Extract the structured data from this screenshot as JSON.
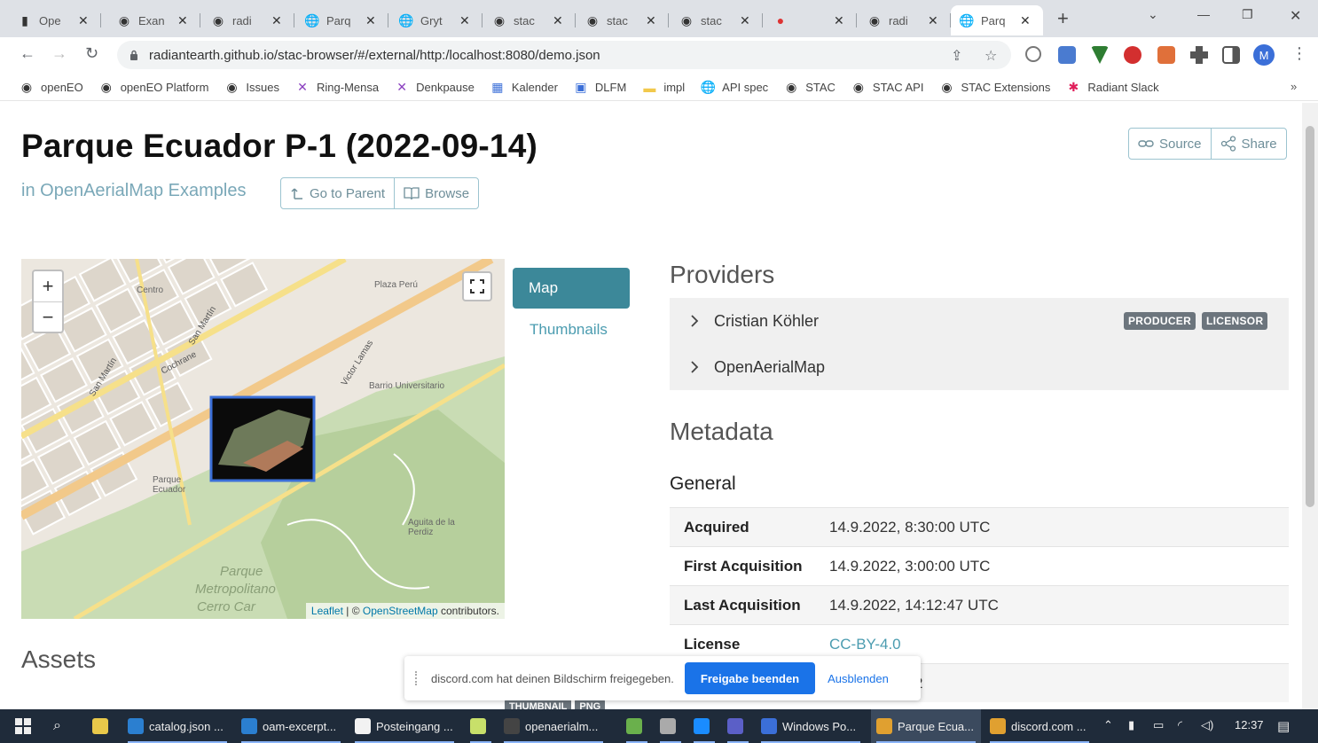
{
  "browser": {
    "tabs": [
      {
        "title": "Ope",
        "icon": "chart-icon"
      },
      {
        "title": "Exan",
        "icon": "github-icon"
      },
      {
        "title": "radi",
        "icon": "github-icon"
      },
      {
        "title": "Parq",
        "icon": "globe-icon"
      },
      {
        "title": "Gryt",
        "icon": "globe-icon"
      },
      {
        "title": "stac",
        "icon": "github-icon"
      },
      {
        "title": "stac",
        "icon": "github-icon"
      },
      {
        "title": "stac",
        "icon": "github-icon"
      },
      {
        "title": "",
        "icon": "record-icon"
      },
      {
        "title": "radi",
        "icon": "github-icon"
      },
      {
        "title": "Parq",
        "icon": "globe-icon",
        "active": true
      }
    ],
    "new_tab": "+",
    "url": "radiantearth.github.io/stac-browser/#/external/http:/localhost:8080/demo.json",
    "profile_initial": "M",
    "bookmarks": [
      {
        "label": "openEO",
        "icon": "github-icon"
      },
      {
        "label": "openEO Platform",
        "icon": "github-icon"
      },
      {
        "label": "Issues",
        "icon": "github-icon"
      },
      {
        "label": "Ring-Mensa",
        "icon": "x-icon"
      },
      {
        "label": "Denkpause",
        "icon": "x-icon"
      },
      {
        "label": "Kalender",
        "icon": "calendar-icon"
      },
      {
        "label": "DLFM",
        "icon": "dlfm-icon"
      },
      {
        "label": "impl",
        "icon": "folder-icon"
      },
      {
        "label": "API spec",
        "icon": "globe-icon"
      },
      {
        "label": "STAC",
        "icon": "github-icon"
      },
      {
        "label": "STAC API",
        "icon": "github-icon"
      },
      {
        "label": "STAC Extensions",
        "icon": "github-icon"
      },
      {
        "label": "Radiant Slack",
        "icon": "slack-icon"
      }
    ],
    "bookmarks_more": "»"
  },
  "page": {
    "title": "Parque Ecuador P-1 (2022-09-14)",
    "parent_prefix": "in",
    "parent_link": "OpenAerialMap Examples",
    "go_to_parent": "Go to Parent",
    "browse": "Browse",
    "source": "Source",
    "share": "Share",
    "map_tab": "Map",
    "thumbnails_tab": "Thumbnails",
    "map_labels": {
      "zoom_in": "+",
      "zoom_out": "−",
      "street_centro": "Centro",
      "street_plaza": "Plaza Perú",
      "street_sanmartin": "San Martín",
      "street_cochrane": "Cochrane",
      "street_victor": "Victor Lamas",
      "barrio": "Barrio Universitario",
      "parque_ecuador": "Parque Ecuador",
      "aguita": "Aguita de la Perdiz",
      "parque_metro_1": "Parque",
      "parque_metro_2": "Metropolitano",
      "parque_metro_3": "Cerro Car",
      "leaflet": "Leaflet",
      "attrib_sep": "| ©",
      "osm": "OpenStreetMap",
      "attrib_tail": "contributors."
    },
    "providers_heading": "Providers",
    "providers": [
      {
        "name": "Cristian Köhler",
        "roles": [
          "PRODUCER",
          "LICENSOR"
        ]
      },
      {
        "name": "OpenAerialMap",
        "roles": []
      }
    ],
    "metadata_heading": "Metadata",
    "general_heading": "General",
    "metadata": [
      {
        "key": "Acquired",
        "value": "14.9.2022, 8:30:00 UTC"
      },
      {
        "key": "First Acquisition",
        "value": "14.9.2022, 3:00:00 UTC"
      },
      {
        "key": "Last Acquisition",
        "value": "14.9.2022, 14:12:47 UTC"
      },
      {
        "key": "License",
        "value": "CC-BY-4.0",
        "link": true
      },
      {
        "key": "",
        "value": "2"
      }
    ],
    "assets_heading": "Assets",
    "asset_badges": [
      "THUMBNAIL",
      "PNG"
    ]
  },
  "share_notice": {
    "text": "discord.com hat deinen Bildschirm freigegeben.",
    "stop": "Freigabe beenden",
    "hide": "Ausblenden"
  },
  "taskbar": {
    "items": [
      {
        "label": "catalog.json ...",
        "color": "#2b7fd0"
      },
      {
        "label": "oam-excerpt...",
        "color": "#2b7fd0"
      },
      {
        "label": "Posteingang ...",
        "color": "#f2f2f2"
      },
      {
        "label": "",
        "color": "#c8e06a"
      },
      {
        "label": "openaerialm...",
        "color": "#444"
      },
      {
        "label": "",
        "color": "#6ab04c"
      },
      {
        "label": "",
        "color": "#aaa"
      },
      {
        "label": "",
        "color": "#1a8cff"
      },
      {
        "label": "",
        "color": "#5b5fc7"
      },
      {
        "label": "Windows Po...",
        "color": "#3b6fd8"
      },
      {
        "label": "Parque Ecua...",
        "color": "#e0a030",
        "active": true
      },
      {
        "label": "discord.com ...",
        "color": "#e0a030"
      }
    ],
    "time": "12:37"
  },
  "colors": {
    "accent": "#3c8899",
    "link": "#4b9cb0",
    "badge": "#6c757d",
    "chrome_blue": "#1a73e8"
  }
}
